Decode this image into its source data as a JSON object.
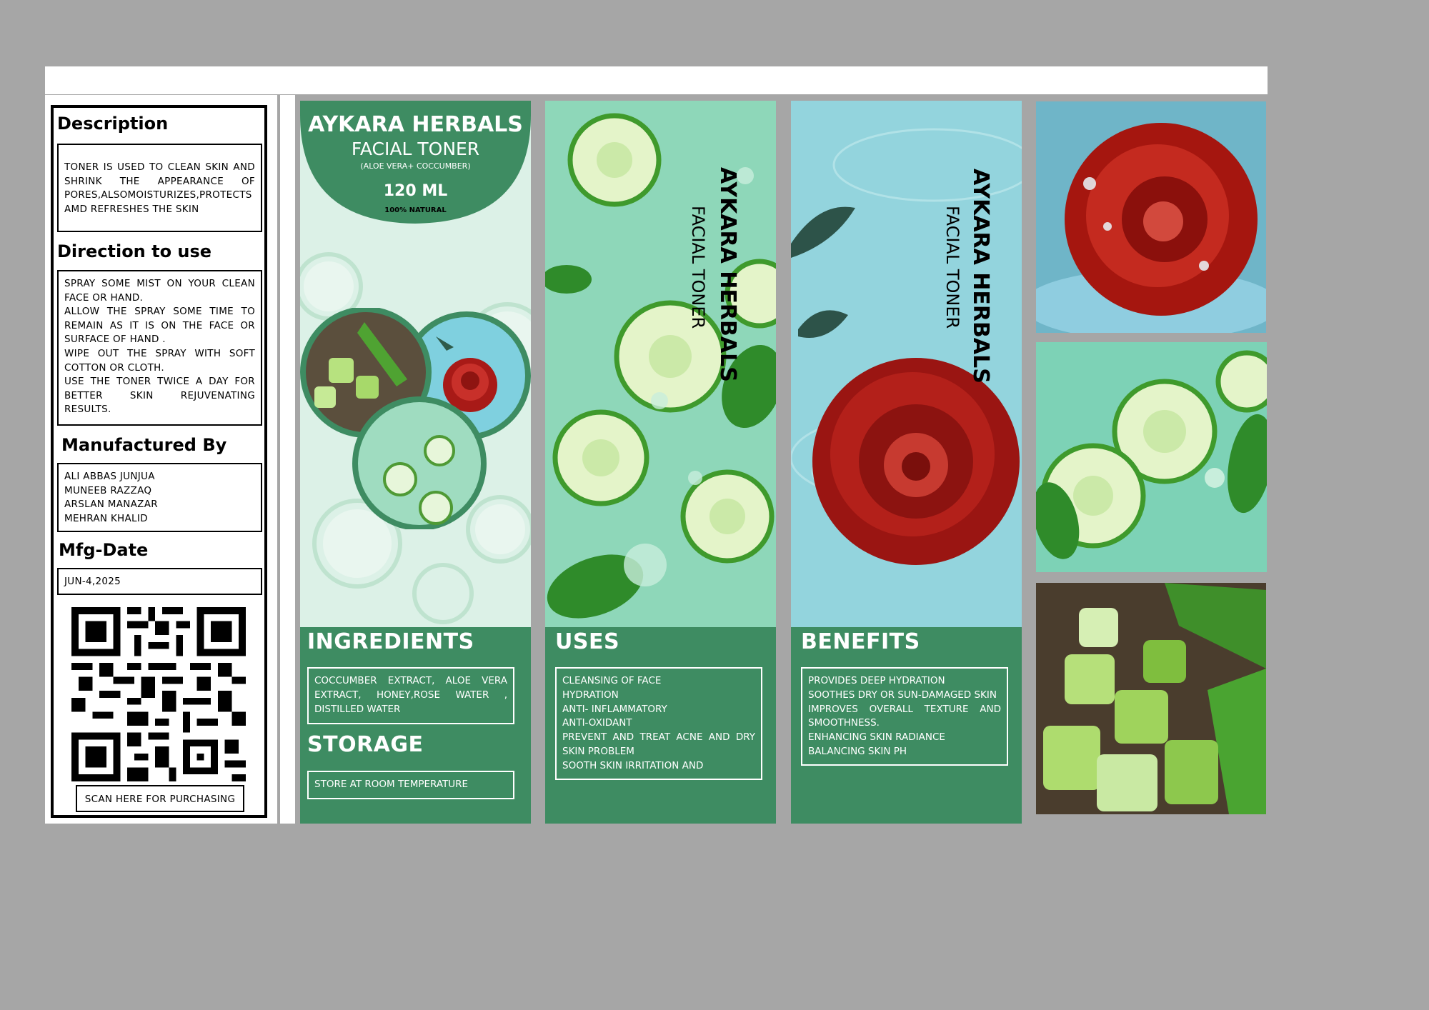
{
  "left": {
    "description_title": "Description",
    "description_text": "TONER IS USED TO CLEAN SKIN AND SHRINK THE APPEARANCE OF PORES,ALSOMOISTURIZES,PROTECTS AMD REFRESHES THE SKIN",
    "direction_title": "Direction to use",
    "directions": [
      "SPRAY SOME MIST ON YOUR CLEAN FACE OR HAND.",
      "ALLOW THE SPRAY SOME TIME TO REMAIN AS IT IS ON THE FACE OR SURFACE OF HAND .",
      "WIPE OUT THE SPRAY WITH SOFT COTTON OR CLOTH.",
      "USE THE TONER TWICE A DAY FOR BETTER SKIN REJUVENATING RESULTS."
    ],
    "manufactured_title": "Manufactured By",
    "manufacturers": [
      "ALI ABBAS JUNJUA",
      "MUNEEB RAZZAQ",
      "ARSLAN MANAZAR",
      "MEHRAN  KHALID"
    ],
    "mfg_title": "Mfg-Date",
    "mfg_date": "JUN-4,2025",
    "scan_label": "SCAN HERE FOR PURCHASING"
  },
  "front": {
    "brand": "AYKARA  HERBALS",
    "product": "FACIAL TONER",
    "subtitle": "(ALOE VERA+ COCCUMBER)",
    "volume": "120 ML",
    "natural": "100% NATURAL",
    "ingredients_title": "INGREDIENTS",
    "ingredients_text": "COCCUMBER EXTRACT, ALOE VERA EXTRACT, HONEY,ROSE WATER , DISTILLED WATER",
    "storage_title": "STORAGE",
    "storage_text": "STORE AT ROOM TEMPERATURE"
  },
  "uses_panel": {
    "brand": "AYKARA HERBALS",
    "product": "FACIAL TONER",
    "title": "USES",
    "items": [
      "CLEANSING OF FACE",
      "HYDRATION",
      "ANTI- INFLAMMATORY",
      "ANTI-OXIDANT",
      "PREVENT AND TREAT ACNE AND DRY SKIN PROBLEM",
      "SOOTH SKIN IRRITATION AND"
    ]
  },
  "benefits_panel": {
    "brand": "AYKARA HERBALS",
    "product": "FACIAL TONER",
    "title": "BENEFITS",
    "items": [
      "PROVIDES DEEP HYDRATION",
      "SOOTHES DRY OR SUN-DAMAGED SKIN",
      "IMPROVES OVERALL TEXTURE AND SMOOTHNESS.",
      "ENHANCING SKIN RADIANCE",
      "BALANCING SKIN PH"
    ]
  },
  "colors": {
    "brand_green": "#3e8c62",
    "background_gray": "#a6a6a6",
    "mint": "#9fdcc0",
    "aqua": "#8fd3dc",
    "rose_red": "#b3201a"
  },
  "icons": [
    "qr-code-icon",
    "cucumber-slice-icon",
    "rose-icon",
    "aloe-vera-icon",
    "water-drop-icon",
    "basil-leaf-icon"
  ]
}
